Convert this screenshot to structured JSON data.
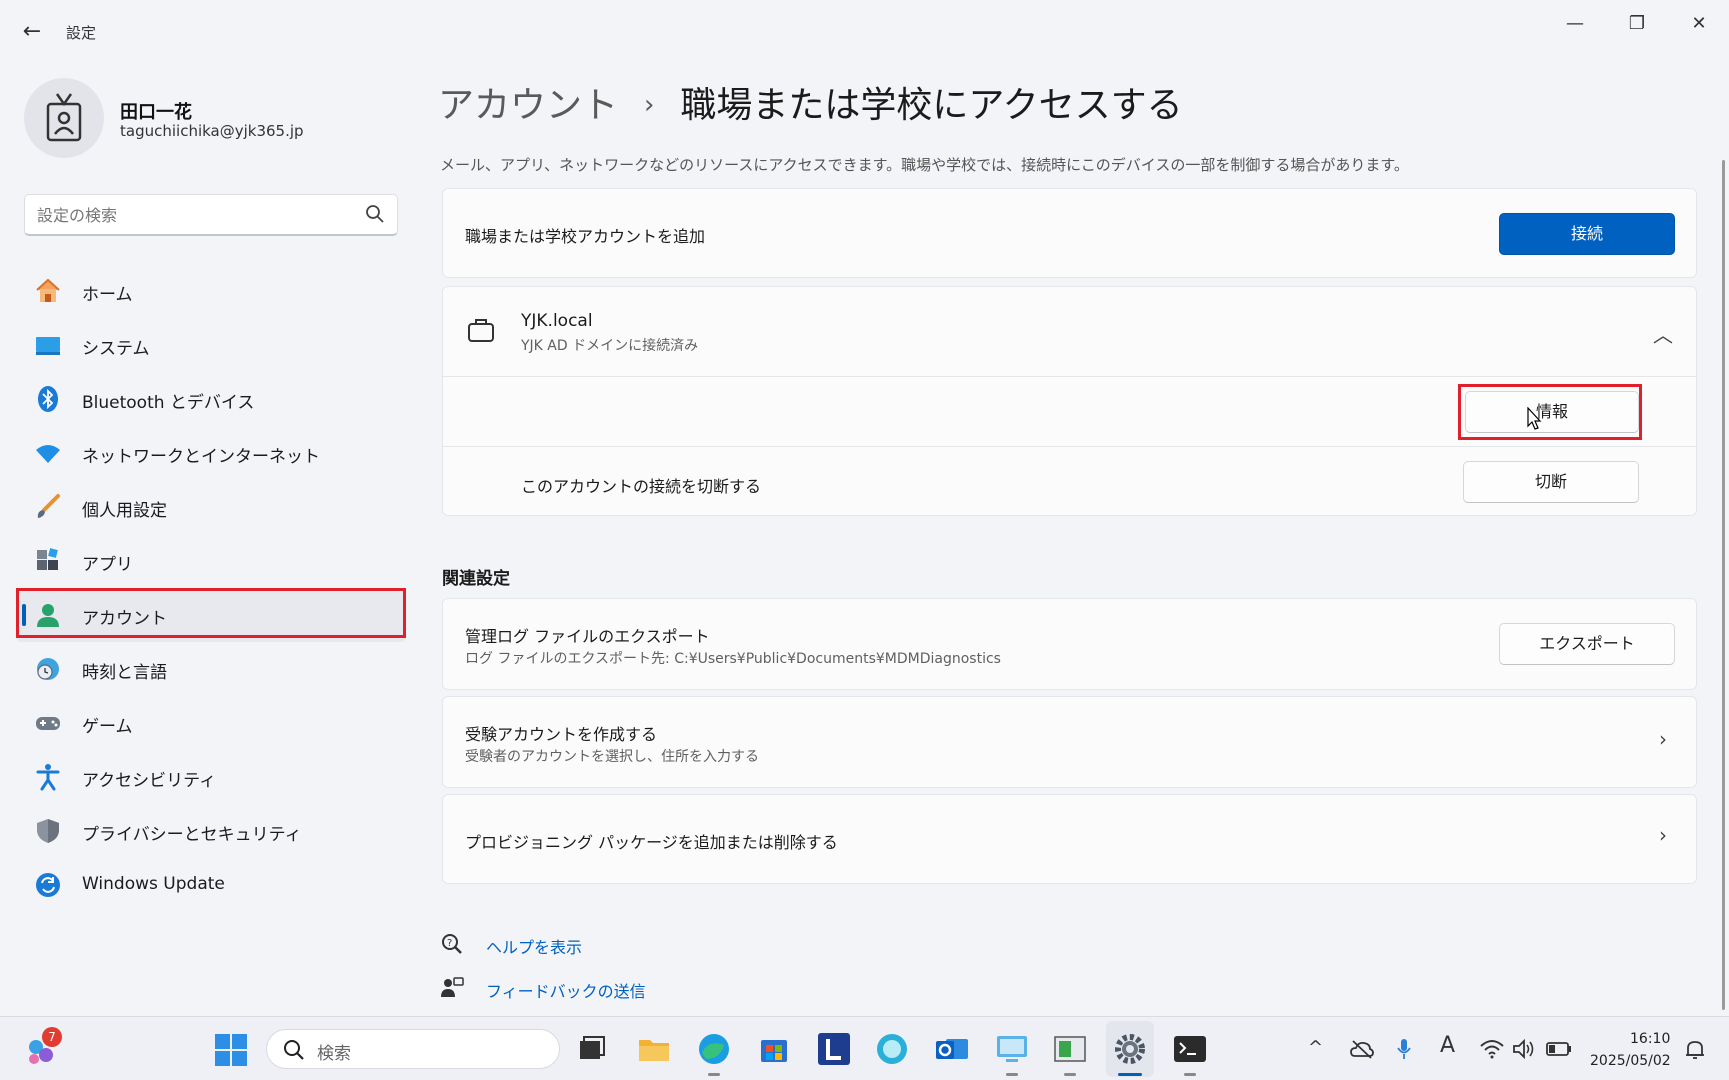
{
  "window": {
    "title": "設定"
  },
  "profile": {
    "name": "田口一花",
    "email": "taguchiichika@yjk365.jp"
  },
  "search": {
    "placeholder": "設定の検索"
  },
  "nav": {
    "items": [
      {
        "label": "ホーム",
        "icon": "home-icon"
      },
      {
        "label": "システム",
        "icon": "system-icon"
      },
      {
        "label": "Bluetooth とデバイス",
        "icon": "bluetooth-icon"
      },
      {
        "label": "ネットワークとインターネット",
        "icon": "wifi-icon"
      },
      {
        "label": "個人用設定",
        "icon": "brush-icon"
      },
      {
        "label": "アプリ",
        "icon": "apps-icon"
      },
      {
        "label": "アカウント",
        "icon": "account-icon",
        "selected": true
      },
      {
        "label": "時刻と言語",
        "icon": "time-language-icon"
      },
      {
        "label": "ゲーム",
        "icon": "gamepad-icon"
      },
      {
        "label": "アクセシビリティ",
        "icon": "accessibility-icon"
      },
      {
        "label": "プライバシーとセキュリティ",
        "icon": "shield-icon"
      },
      {
        "label": "Windows Update",
        "icon": "update-icon"
      }
    ]
  },
  "breadcrumb": {
    "parent": "アカウント",
    "sep": "›",
    "current": "職場または学校にアクセスする"
  },
  "description": "メール、アプリ、ネットワークなどのリソースにアクセスできます。職場や学校では、接続時にこのデバイスの一部を制御する場合があります。",
  "add_account": {
    "title": "職場または学校アカウントを追加",
    "button": "接続"
  },
  "connected_account": {
    "name": "YJK.local",
    "status": "YJK AD ドメインに接続済み",
    "info_button": "情報",
    "disconnect_label": "このアカウントの接続を切断する",
    "disconnect_button": "切断"
  },
  "related": {
    "title": "関連設定",
    "export": {
      "title": "管理ログ ファイルのエクスポート",
      "sub": "ログ ファイルのエクスポート先: C:¥Users¥Public¥Documents¥MDMDiagnostics",
      "button": "エクスポート"
    },
    "exam": {
      "title": "受験アカウントを作成する",
      "sub": "受験者のアカウントを選択し、住所を入力する"
    },
    "provisioning": {
      "title": "プロビジョニング パッケージを追加または削除する"
    }
  },
  "links": {
    "help": "ヘルプを表示",
    "feedback": "フィードバックの送信"
  },
  "taskbar": {
    "search_placeholder": "検索",
    "widgets_badge": "7",
    "time": "16:10",
    "date": "2025/05/02",
    "ime": "A"
  },
  "colors": {
    "accent": "#0061c1",
    "highlight": "#e0212b"
  }
}
